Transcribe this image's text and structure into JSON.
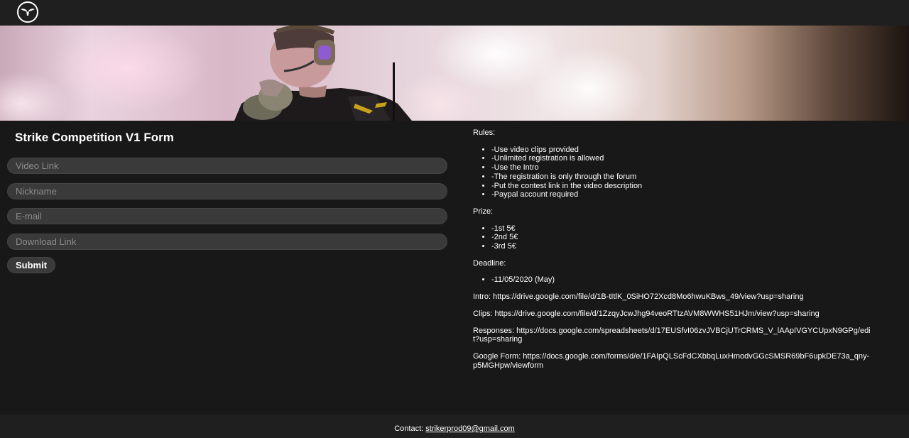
{
  "header": {
    "logo_icon": "drone-logo-icon"
  },
  "banner": {
    "image": "soldier-banner"
  },
  "form": {
    "title": "Strike Competition V1 Form",
    "video_link_placeholder": "Video Link",
    "nickname_placeholder": "Nickname",
    "email_placeholder": "E-mail",
    "download_link_placeholder": "Download Link",
    "submit_label": "Submit"
  },
  "info": {
    "rules_heading": "Rules:",
    "rules": [
      "-Use video clips provided",
      "-Unlimited registration is allowed",
      "-Use the Intro",
      "-The registration is only through the forum",
      "-Put the contest link in the video description",
      "-Paypal account required"
    ],
    "prize_heading": "Prize:",
    "prizes": [
      "-1st 5€",
      "-2nd 5€",
      "-3rd 5€"
    ],
    "deadline_heading": "Deadline:",
    "deadlines": [
      "-11/05/2020 (May)"
    ],
    "intro": "Intro: https://drive.google.com/file/d/1B-tItlK_0SiHO72Xcd8Mo6hwuKBws_49/view?usp=sharing",
    "clips": "Clips: https://drive.google.com/file/d/1ZzqyJcwJhg94veoRTtzAVM8WWHS51HJm/view?usp=sharing",
    "responses": "Responses: https://docs.google.com/spreadsheets/d/17EUSfvI06zvJVBCjUTrCRMS_V_lAApIVGYCUpxN9GPg/edit?usp=sharing",
    "google_form": "Google Form: https://docs.google.com/forms/d/e/1FAIpQLScFdCXbbqLuxHmodvGGcSMSR69bF6upkDE73a_qny-p5MGHpw/viewform"
  },
  "footer": {
    "contact_label": "Contact: ",
    "email": "strikerprod09@gmail.com"
  },
  "colors": {
    "background": "#181818",
    "bar": "#1f1f1f",
    "field": "#3a3a3a",
    "text": "#ffffff"
  }
}
